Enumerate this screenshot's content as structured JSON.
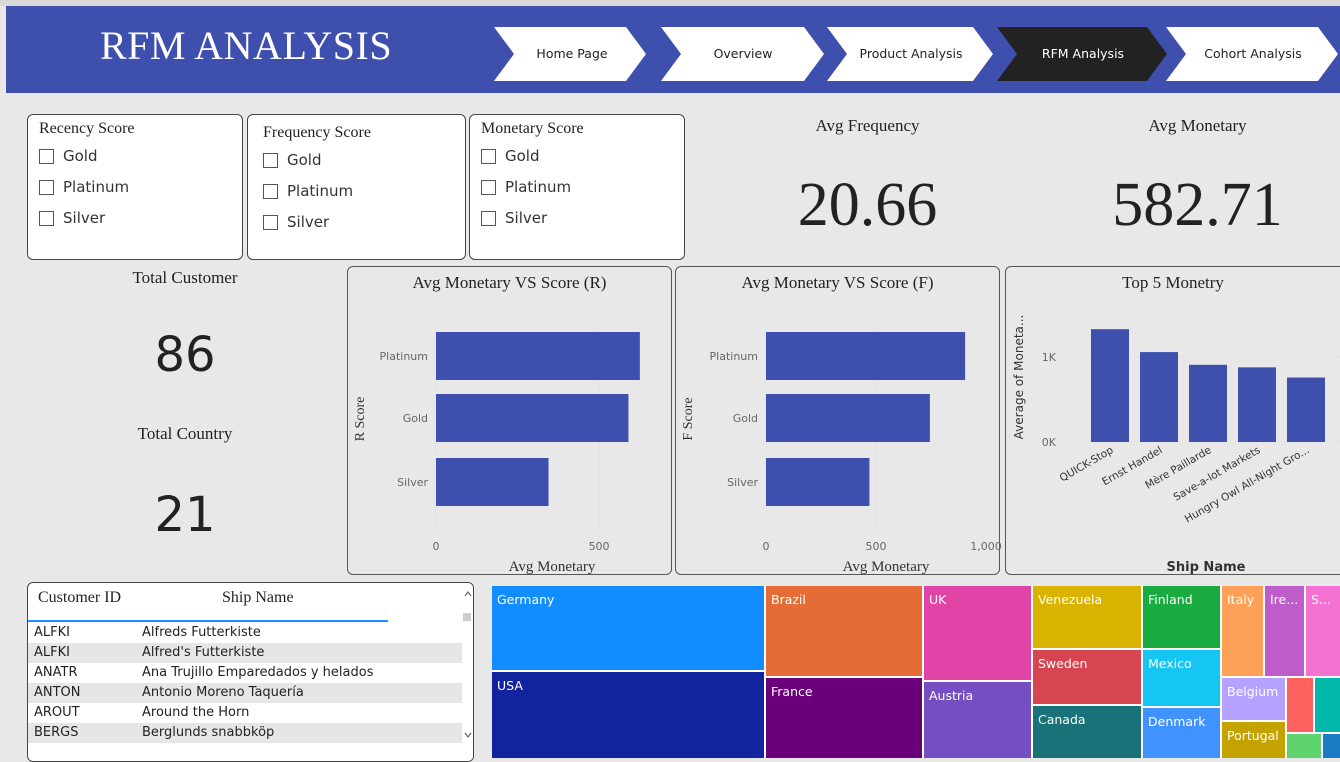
{
  "header": {
    "title": "RFM ANALYSIS",
    "nav": [
      {
        "label": "Home Page",
        "active": false
      },
      {
        "label": "Overview",
        "active": false
      },
      {
        "label": "Product Analysis",
        "active": false
      },
      {
        "label": "RFM Analysis",
        "active": true
      },
      {
        "label": "Cohort Analysis",
        "active": false
      }
    ]
  },
  "slicers": [
    {
      "title": "Recency Score",
      "options": [
        "Gold",
        "Platinum",
        "Silver"
      ]
    },
    {
      "title": "Frequency Score",
      "options": [
        "Gold",
        "Platinum",
        "Silver"
      ]
    },
    {
      "title": "Monetary Score",
      "options": [
        "Gold",
        "Platinum",
        "Silver"
      ]
    }
  ],
  "kpis": {
    "avg_frequency": {
      "label": "Avg Frequency",
      "value": "20.66"
    },
    "avg_monetary": {
      "label": "Avg Monetary",
      "value": "582.71"
    },
    "total_customer": {
      "label": "Total Customer",
      "value": "86"
    },
    "total_country": {
      "label": "Total Country",
      "value": "21"
    }
  },
  "chart_data": [
    {
      "type": "bar",
      "orientation": "horizontal",
      "title": "Avg Monetary VS Score (R)",
      "xlabel": "Avg Monetary",
      "ylabel": "R Score",
      "categories": [
        "Platinum",
        "Gold",
        "Silver"
      ],
      "values": [
        625,
        590,
        345
      ],
      "xlim": [
        0,
        650
      ],
      "xticks": [
        "0",
        "500"
      ],
      "color": "#3f4fae"
    },
    {
      "type": "bar",
      "orientation": "horizontal",
      "title": "Avg Monetary VS Score (F)",
      "xlabel": "Avg Monetary",
      "ylabel": "F Score",
      "categories": [
        "Platinum",
        "Gold",
        "Silver"
      ],
      "values": [
        905,
        745,
        470
      ],
      "xlim": [
        0,
        1000
      ],
      "xticks": [
        "0",
        "500",
        "1,000"
      ],
      "color": "#3f4fae"
    },
    {
      "type": "bar",
      "title": "Top 5 Monetry",
      "xlabel": "Ship Name",
      "ylabel": "Average of Moneta...",
      "categories": [
        "QUICK-Stop",
        "Ernst Handel",
        "Mère Paillarde",
        "Save-a-lot Markets",
        "Hungry Owl All-Night Gro..."
      ],
      "values": [
        1330,
        1060,
        910,
        880,
        760
      ],
      "ylim": [
        0,
        1450
      ],
      "yticks": [
        "0K",
        "1K"
      ],
      "color": "#3f4fae"
    },
    {
      "type": "treemap",
      "categories": [
        "Germany",
        "USA",
        "Brazil",
        "France",
        "UK",
        "Austria",
        "Venezuela",
        "Sweden",
        "Canada",
        "Finland",
        "Mexico",
        "Denmark",
        "Italy",
        "Ire...",
        "S...",
        "Belgium",
        "Portugal"
      ],
      "colors": [
        "#118dff",
        "#12239e",
        "#e66c37",
        "#6b007b",
        "#e044a7",
        "#744ec2",
        "#d9b300",
        "#d64550",
        "#197278",
        "#1aab40",
        "#15c6f4",
        "#4092ff",
        "#ffa058",
        "#be5dc9",
        "#f472d0",
        "#b5a1ff",
        "#c4a200"
      ]
    }
  ],
  "table": {
    "headers": [
      "Customer ID",
      "Ship Name"
    ],
    "rows": [
      [
        "ALFKI",
        "Alfreds Futterkiste"
      ],
      [
        "ALFKI",
        "Alfred's Futterkiste"
      ],
      [
        "ANATR",
        "Ana Trujillo Emparedados y helados"
      ],
      [
        "ANTON",
        "Antonio Moreno Taquería"
      ],
      [
        "AROUT",
        "Around the Horn"
      ],
      [
        "BERGS",
        "Berglunds snabbköp"
      ]
    ]
  }
}
